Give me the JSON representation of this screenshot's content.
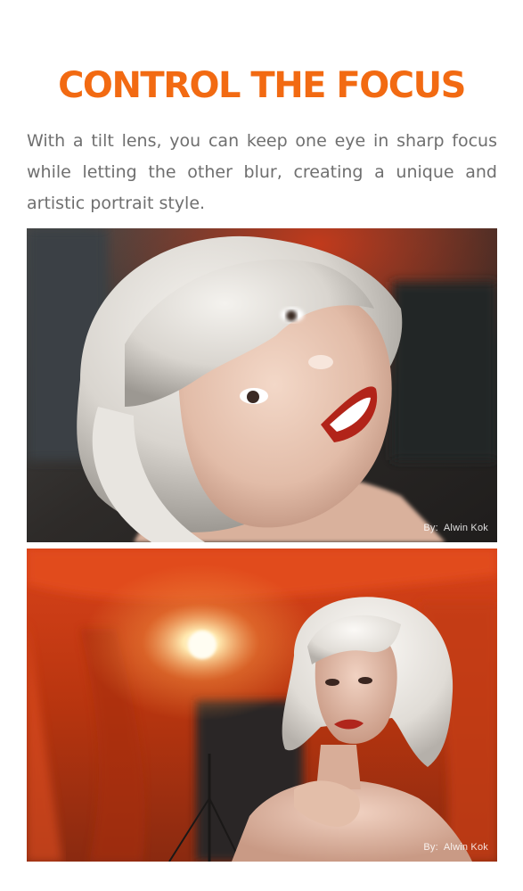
{
  "article": {
    "title": "CONTROL THE FOCUS",
    "body": "With a tilt lens, you can keep one eye in sharp focus while letting the other blur, creating a unique and artistic portrait style."
  },
  "photos": [
    {
      "subject": "close-up portrait of a smiling woman with platinum wavy hair, tilted head, one eye sharp",
      "credit_prefix": "By:",
      "credit_name": "Alwin Kok"
    },
    {
      "subject": "woman with white bob hair in front of red draped fabric with a bright lamp",
      "credit_prefix": "By:",
      "credit_name": "Alwin Kok"
    }
  ],
  "colors": {
    "accent": "#f26a12",
    "body_text": "#6f6f6f",
    "background": "#ffffff"
  }
}
